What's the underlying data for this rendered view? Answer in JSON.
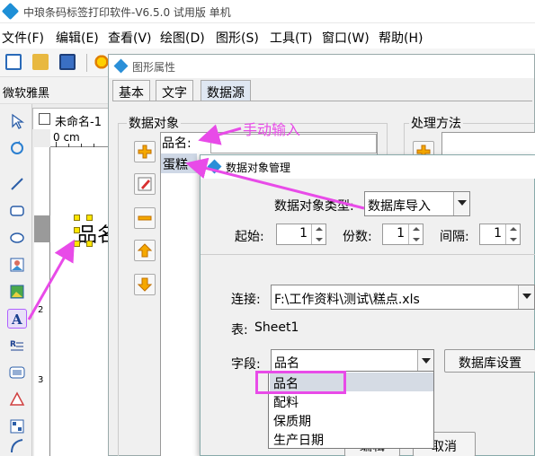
{
  "window": {
    "title": "中琅条码标签打印软件-V6.5.0 试用版 单机"
  },
  "menu": {
    "items": [
      "文件(F)",
      "编辑(E)",
      "查看(V)",
      "绘图(D)",
      "图形(S)",
      "工具(T)",
      "窗口(W)",
      "帮助(H)"
    ]
  },
  "fontbar": {
    "font_name": "微软雅黑"
  },
  "document": {
    "tab_title": "未命名-1",
    "ruler_unit": "0 cm",
    "ruler_v1": "1",
    "ruler_v2": "2",
    "ruler_v3": "3",
    "canvas_text": "品名"
  },
  "props_dialog": {
    "title": "图形属性",
    "tabs": [
      "基本",
      "文字",
      "数据源"
    ],
    "active_tab": "数据源",
    "data_object_label": "数据对象",
    "process_label": "处理方法",
    "row1_text": "品名:",
    "row2_text": "蛋糕"
  },
  "data_dialog": {
    "title": "数据对象管理",
    "type_label": "数据对象类型:",
    "type_value": "数据库导入",
    "start_label": "起始:",
    "start_value": "1",
    "copies_label": "份数:",
    "copies_value": "1",
    "interval_label": "间隔:",
    "interval_value": "1",
    "connection_label": "连接:",
    "connection_value": "F:\\工作资料\\测试\\糕点.xls",
    "table_label": "表:",
    "table_value": "Sheet1",
    "field_label": "字段:",
    "field_value": "品名",
    "db_settings_button": "数据库设置",
    "ok_button": "编辑",
    "cancel_button": "取消",
    "field_options": [
      "品名",
      "配料",
      "保质期",
      "生产日期"
    ]
  },
  "annotation": {
    "manual_input": "手动输入"
  },
  "colors": {
    "accent": "#e84be8",
    "selection": "#d5dbe4"
  }
}
